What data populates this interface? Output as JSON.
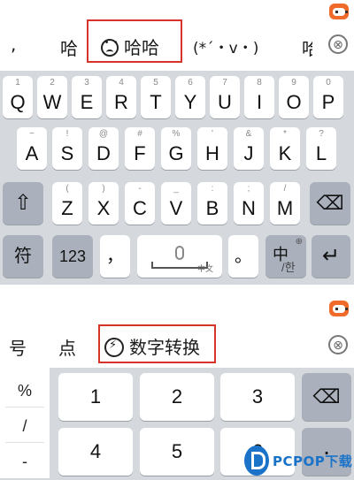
{
  "top_panel": {
    "candidates": [
      ",",
      "哈",
      "哈哈",
      "(*´・v・)",
      "哈"
    ],
    "highlighted_candidate": "哈哈",
    "close_icon": "⊗",
    "keyboard": {
      "row1": [
        {
          "main": "Q",
          "sub": "1"
        },
        {
          "main": "W",
          "sub": "2"
        },
        {
          "main": "E",
          "sub": "3"
        },
        {
          "main": "R",
          "sub": "4"
        },
        {
          "main": "T",
          "sub": "5"
        },
        {
          "main": "Y",
          "sub": "6"
        },
        {
          "main": "U",
          "sub": "7"
        },
        {
          "main": "I",
          "sub": "8"
        },
        {
          "main": "O",
          "sub": "9"
        },
        {
          "main": "P",
          "sub": "0"
        }
      ],
      "row2": [
        {
          "main": "A",
          "sub": "~"
        },
        {
          "main": "S",
          "sub": "!"
        },
        {
          "main": "D",
          "sub": "@"
        },
        {
          "main": "F",
          "sub": "#"
        },
        {
          "main": "G",
          "sub": "%"
        },
        {
          "main": "H",
          "sub": "'"
        },
        {
          "main": "J",
          "sub": "&"
        },
        {
          "main": "K",
          "sub": "*"
        },
        {
          "main": "L",
          "sub": "?"
        }
      ],
      "row3": [
        {
          "main": "Z",
          "sub": "("
        },
        {
          "main": "X",
          "sub": ")"
        },
        {
          "main": "C",
          "sub": "-"
        },
        {
          "main": "V",
          "sub": "_"
        },
        {
          "main": "B",
          "sub": ":"
        },
        {
          "main": "N",
          "sub": ";"
        },
        {
          "main": "M",
          "sub": "/"
        }
      ],
      "shift_icon": "⇧",
      "backspace_icon": "⌫",
      "symbol_label": "符",
      "number_label": "123",
      "comma_label": "，",
      "space_tag": "中文",
      "period_label": "。",
      "lang_label": "中",
      "lang_sub": "/한",
      "return_icon": "↵"
    }
  },
  "bottom_panel": {
    "candidates": [
      "号",
      "点"
    ],
    "highlighted_candidate": "数字转换",
    "close_icon": "⊗",
    "side_keys": [
      "%",
      "/",
      "-"
    ],
    "number_keys": [
      "1",
      "2",
      "3",
      "4",
      "5",
      "6"
    ],
    "backspace_icon": "⌫",
    "dot_label": "·"
  },
  "watermark": {
    "text": "PCPOP下载"
  }
}
